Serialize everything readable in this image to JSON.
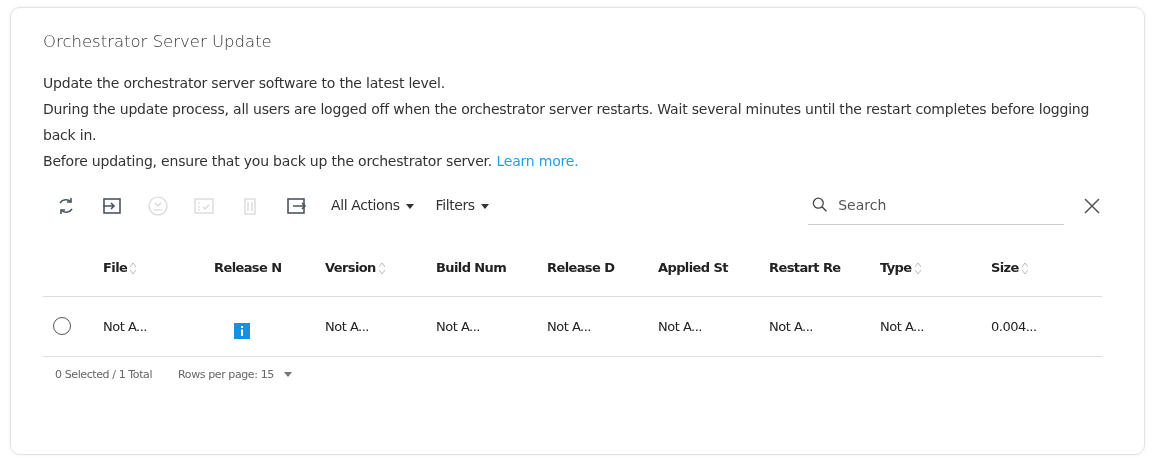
{
  "card": {
    "title": "Orchestrator Server Update",
    "paragraphs": [
      "Update the orchestrator server software to the latest level.",
      "During the update process, all users are logged off when the orchestrator server restarts. Wait several minutes until the restart completes before logging back in."
    ],
    "note": {
      "text": "Before updating, ensure that you back up the orchestrator server.",
      "link": "Learn more."
    }
  },
  "toolbar": {
    "tools": [
      {
        "kind": "refresh",
        "disabled": false
      },
      {
        "kind": "import",
        "disabled": false
      },
      {
        "kind": "download",
        "disabled": true
      },
      {
        "kind": "checklist",
        "disabled": true
      },
      {
        "kind": "trash",
        "disabled": true
      },
      {
        "kind": "export",
        "disabled": false
      }
    ],
    "menus": [
      "All Actions",
      "Filters"
    ],
    "search": {
      "placeholder": "Search"
    }
  },
  "table": {
    "columns": [
      {
        "label": "File",
        "sortable": true
      },
      {
        "label": "Release N",
        "sortable": false
      },
      {
        "label": "Version",
        "sortable": true
      },
      {
        "label": "Build Num",
        "sortable": false
      },
      {
        "label": "Release D",
        "sortable": false
      },
      {
        "label": "Applied St",
        "sortable": false
      },
      {
        "label": "Restart Re",
        "sortable": false
      },
      {
        "label": "Type",
        "sortable": true
      },
      {
        "label": "Size",
        "sortable": true
      }
    ],
    "rows": [
      {
        "selected": false,
        "cells": [
          {
            "kind": "text",
            "text": "Not A..."
          },
          {
            "kind": "info"
          },
          {
            "kind": "text",
            "text": "Not A..."
          },
          {
            "kind": "text",
            "text": "Not A..."
          },
          {
            "kind": "text",
            "text": "Not A..."
          },
          {
            "kind": "text",
            "text": "Not A..."
          },
          {
            "kind": "text",
            "text": "Not A..."
          },
          {
            "kind": "text",
            "text": "Not A..."
          },
          {
            "kind": "text",
            "text": "0.004..."
          }
        ]
      }
    ]
  },
  "footer": {
    "summary": "0 Selected / 1 Total",
    "rows_per_page": "Rows per page: 15"
  }
}
